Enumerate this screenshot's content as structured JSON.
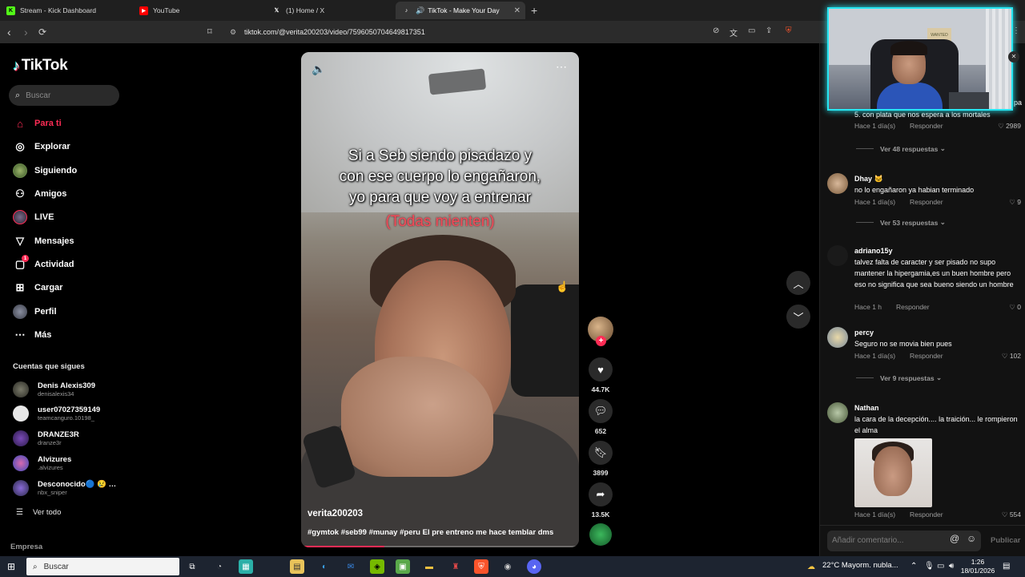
{
  "browser": {
    "tabs": [
      {
        "label": "Stream - Kick Dashboard",
        "icon": "K",
        "color": "#53fc18"
      },
      {
        "label": "YouTube",
        "icon": "▶",
        "color": "#ff0000"
      },
      {
        "label": "(1) Home / X",
        "icon": "𝕏",
        "color": "#ffffff"
      },
      {
        "label": "TikTok - Make Your Day",
        "icon": "♪",
        "color": "#ffffff"
      }
    ],
    "active_tab": 3,
    "url": "tiktok.com/@verita200203/video/7596050704649817351"
  },
  "sidebar": {
    "logo": "TikTok",
    "search_placeholder": "Buscar",
    "nav": [
      {
        "label": "Para ti",
        "icon": "home-icon"
      },
      {
        "label": "Explorar",
        "icon": "compass-icon"
      },
      {
        "label": "Siguiendo",
        "icon": "following-avatar"
      },
      {
        "label": "Amigos",
        "icon": "friends-icon"
      },
      {
        "label": "LIVE",
        "icon": "live-avatar"
      },
      {
        "label": "Mensajes",
        "icon": "messages-icon"
      },
      {
        "label": "Actividad",
        "icon": "activity-icon"
      },
      {
        "label": "Cargar",
        "icon": "upload-icon"
      },
      {
        "label": "Perfil",
        "icon": "profile-avatar"
      },
      {
        "label": "Más",
        "icon": "more-icon"
      }
    ],
    "activity_badge": "1",
    "following_title": "Cuentas que sigues",
    "following": [
      {
        "name": "Denis Alexis309",
        "handle": "denisalexis34"
      },
      {
        "name": "user07027359149",
        "handle": "teamcanguro.10198_"
      },
      {
        "name": "DRANZE3R",
        "handle": "dranze3r"
      },
      {
        "name": "Alvizures",
        "handle": ".alvizures"
      },
      {
        "name": "Desconocido🔵 😢 …",
        "handle": "nbx_sniper"
      }
    ],
    "see_all": "Ver todo",
    "company": "Empresa"
  },
  "video": {
    "overlay_lines": [
      "Si a Seb siendo pisadazo y",
      "con ese cuerpo lo engañaron,",
      "yo para que voy a entrenar"
    ],
    "overlay_red": "(Todas mienten)",
    "author": "verita200203",
    "caption": "#gymtok #seb99 #munay #peru El pre entreno me hace temblar dms",
    "progress_fraction": 0.3
  },
  "actions": {
    "likes": "44.7K",
    "comments": "652",
    "saves": "3899",
    "shares": "13.5K"
  },
  "comments": {
    "top_partial": {
      "tail": "pa",
      "text": "5. con plata que nos espera a los mortales",
      "time": "Hace 1 día(s)",
      "reply": "Responder",
      "likes": "2989"
    },
    "replies_1": "Ver 48 respuestas",
    "items": [
      {
        "name": "Dhay 🐱",
        "text": "no lo engañaron ya habian terminado",
        "time": "Hace 1 día(s)",
        "reply": "Responder",
        "likes": "9"
      },
      {
        "name": "adriano15y",
        "text": "talvez falta de caracter y ser pisado no supo mantener la hipergamia,es un buen hombre pero eso no significa que sea bueno siendo un hombre",
        "time": "Hace 1 h",
        "reply": "Responder",
        "likes": "0"
      },
      {
        "name": "percy",
        "text": "Seguro no se movia bien pues",
        "time": "Hace 1 día(s)",
        "reply": "Responder",
        "likes": "102"
      },
      {
        "name": "Nathan",
        "text": "la cara de la decepción.... la traición... le rompieron el alma",
        "time": "Hace 1 día(s)",
        "reply": "Responder",
        "likes": "554"
      }
    ],
    "replies_2": "Ver 53 respuestas",
    "replies_3": "Ver 9 respuestas",
    "input_placeholder": "Añadir comentario...",
    "publish": "Publicar"
  },
  "webcam": {
    "poster_text": "WANTED"
  },
  "taskbar": {
    "search_placeholder": "Buscar",
    "weather": "22°C  Mayorm. nubla...",
    "time": "1:26",
    "date": "18/01/2026"
  }
}
